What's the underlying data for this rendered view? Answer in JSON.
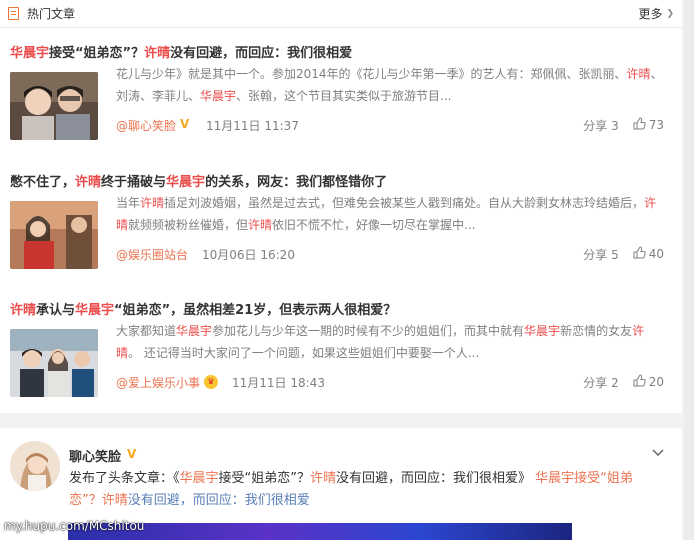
{
  "hot_card": {
    "title": "热门文章",
    "more_label": "更多"
  },
  "articles": [
    {
      "headline": [
        {
          "t": "华晨宇",
          "h": true
        },
        {
          "t": "接受“姐弟恋”？",
          "h": false
        },
        {
          "t": "许晴",
          "h": true
        },
        {
          "t": "没有回避，而回应：我们很相爱",
          "h": false
        }
      ],
      "summary": [
        {
          "t": "花儿与少年》就是其中一个。参加2014年的《花儿与少年第一季》的艺人有：郑佩佩、张凯丽、",
          "h": false
        },
        {
          "t": "许晴",
          "h": true
        },
        {
          "t": "、刘涛、李菲儿、",
          "h": false
        },
        {
          "t": "华晨宇",
          "h": true
        },
        {
          "t": "、张翰，这个节目其实类似于旅游节目...",
          "h": false
        }
      ],
      "author": "@聊心笑脸",
      "badge": "v",
      "date": "11月11日 11:37",
      "share": "分享 3",
      "likes": "73"
    },
    {
      "headline": [
        {
          "t": "憋不住了，",
          "h": false
        },
        {
          "t": "许晴",
          "h": true
        },
        {
          "t": "终于捅破与",
          "h": false
        },
        {
          "t": "华晨宇",
          "h": true
        },
        {
          "t": "的关系，网友：我们都怪错你了",
          "h": false
        }
      ],
      "summary": [
        {
          "t": "当年",
          "h": false
        },
        {
          "t": "许晴",
          "h": true
        },
        {
          "t": "插足刘波婚姻，虽然是过去式，但难免会被某些人戳到痛处。自从大龄剩女林志玲结婚后，",
          "h": false
        },
        {
          "t": "许晴",
          "h": true
        },
        {
          "t": "就频频被粉丝催婚，但",
          "h": false
        },
        {
          "t": "许晴",
          "h": true
        },
        {
          "t": "依旧不慌不忙，好像一切尽在掌握中...",
          "h": false
        }
      ],
      "author": "@娱乐圈站台",
      "badge": "",
      "date": "10月06日 16:20",
      "share": "分享 5",
      "likes": "40"
    },
    {
      "headline": [
        {
          "t": "许晴",
          "h": true
        },
        {
          "t": "承认与",
          "h": false
        },
        {
          "t": "华晨宇",
          "h": true
        },
        {
          "t": "“姐弟恋”，虽然相差21岁，但表示两人很相爱？",
          "h": false
        }
      ],
      "summary": [
        {
          "t": "大家都知道",
          "h": false
        },
        {
          "t": "华晨宇",
          "h": true
        },
        {
          "t": "参加花儿与少年这一期的时候有不少的姐姐们，而其中就有",
          "h": false
        },
        {
          "t": "华晨宇",
          "h": true
        },
        {
          "t": "新恋情的女友",
          "h": false
        },
        {
          "t": "许晴",
          "h": true
        },
        {
          "t": "。  还记得当时大家问了一个问题，如果这些姐姐们中要娶一个人...",
          "h": false
        }
      ],
      "author": "@爱上娱乐小事",
      "badge": "crown",
      "date": "11月11日 18:43",
      "share": "分享 2",
      "likes": "20"
    }
  ],
  "post": {
    "name": "聊心笑脸",
    "text_parts": [
      {
        "t": "发布了头条文章：《",
        "c": ""
      },
      {
        "t": "华晨宇",
        "c": "link"
      },
      {
        "t": "接受“姐弟恋”？",
        "c": ""
      },
      {
        "t": "许晴",
        "c": "link"
      },
      {
        "t": "没有回避，而回应：我们很相爱》 ",
        "c": ""
      },
      {
        "t": "华晨宇接受“姐弟恋”？",
        "c": "link"
      },
      {
        "t": "许晴",
        "c": "link"
      },
      {
        "t": "没有回避，而回应：我们很相爱",
        "c": "link-blue"
      }
    ]
  },
  "watermark": "my.hupu.com/MCshitou",
  "colors": {
    "highlight": "#eb4b4b",
    "link": "#eb7350",
    "link_blue": "#5a7fb6"
  }
}
